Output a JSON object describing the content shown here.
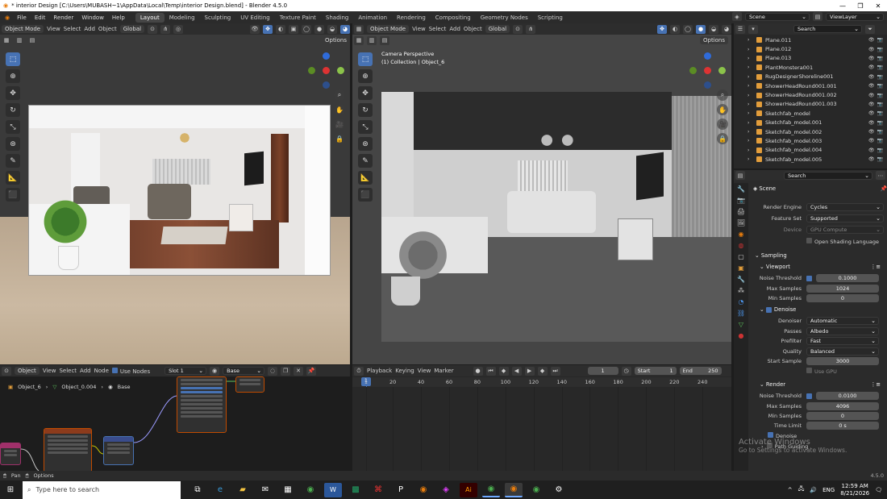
{
  "window": {
    "title": "* interior Design [C:\\Users\\MUBASH~1\\AppData\\Local\\Temp\\interior Design.blend] - Blender 4.5.0"
  },
  "menu": [
    "File",
    "Edit",
    "Render",
    "Window",
    "Help"
  ],
  "workspaces": [
    "Layout",
    "Modeling",
    "Sculpting",
    "UV Editing",
    "Texture Paint",
    "Shading",
    "Animation",
    "Rendering",
    "Compositing",
    "Geometry Nodes",
    "Scripting"
  ],
  "scene": {
    "name": "Scene",
    "view_layer": "ViewLayer"
  },
  "left_viewport": {
    "mode": "Object Mode",
    "menus": [
      "View",
      "Select",
      "Add",
      "Object"
    ],
    "orientation": "Global",
    "options": "Options"
  },
  "right_viewport": {
    "mode": "Object Mode",
    "menus": [
      "View",
      "Select",
      "Add",
      "Object"
    ],
    "orientation": "Global",
    "options": "Options",
    "camera_label": "Camera Perspective",
    "collection_label": "(1) Collection | Object_6"
  },
  "outliner": {
    "search_placeholder": "Search",
    "items": [
      {
        "name": "Plane.011"
      },
      {
        "name": "Plane.012"
      },
      {
        "name": "Plane.013"
      },
      {
        "name": "PlantMonstera001"
      },
      {
        "name": "RugDesignerShoreline001"
      },
      {
        "name": "ShowerHeadRound001.001"
      },
      {
        "name": "ShowerHeadRound001.002"
      },
      {
        "name": "ShowerHeadRound001.003"
      },
      {
        "name": "Sketchfab_model"
      },
      {
        "name": "Sketchfab_model.001"
      },
      {
        "name": "Sketchfab_model.002"
      },
      {
        "name": "Sketchfab_model.003"
      },
      {
        "name": "Sketchfab_model.004"
      },
      {
        "name": "Sketchfab_model.005"
      }
    ]
  },
  "properties": {
    "search_placeholder": "Search",
    "context": "Scene",
    "render_engine_label": "Render Engine",
    "render_engine": "Cycles",
    "feature_set_label": "Feature Set",
    "feature_set": "Supported",
    "device_label": "Device",
    "device": "GPU Compute",
    "open_shading_language": "Open Shading Language",
    "sampling": "Sampling",
    "viewport": "Viewport",
    "noise_threshold_label": "Noise Threshold",
    "viewport_noise_threshold": "0.1000",
    "max_samples_label": "Max Samples",
    "viewport_max_samples": "1024",
    "min_samples_label": "Min Samples",
    "viewport_min_samples": "0",
    "denoise": "Denoise",
    "denoiser_label": "Denoiser",
    "denoiser": "Automatic",
    "passes_label": "Passes",
    "passes": "Albedo",
    "prefilter_label": "Prefilter",
    "prefilter": "Fast",
    "quality_label": "Quality",
    "quality": "Balanced",
    "start_sample_label": "Start Sample",
    "start_sample": "3000",
    "use_gpu": "Use GPU",
    "render": "Render",
    "render_noise_threshold": "0.0100",
    "render_max_samples": "4096",
    "render_min_samples": "0",
    "time_limit_label": "Time Limit",
    "time_limit": "0 s",
    "render_denoise": "Denoise",
    "path_guiding": "Path Guiding",
    "activate_windows": "Activate Windows",
    "activate_windows_sub": "Go to Settings to activate Windows."
  },
  "node_editor": {
    "editor_type": "Object",
    "menus": [
      "View",
      "Select",
      "Add",
      "Node"
    ],
    "use_nodes": "Use Nodes",
    "slot": "Slot 1",
    "material": "Base",
    "breadcrumb": [
      "Object_6",
      "Object_0.004",
      "Base"
    ]
  },
  "timeline": {
    "menus": [
      "Playback",
      "Keying",
      "View",
      "Marker"
    ],
    "current_frame": "1",
    "start_label": "Start",
    "start": "1",
    "end_label": "End",
    "end": "250",
    "ticks": [
      "1",
      "20",
      "40",
      "60",
      "80",
      "100",
      "120",
      "140",
      "160",
      "180",
      "200",
      "220",
      "240"
    ]
  },
  "statusbar": {
    "pan": "Pan",
    "options": "Options",
    "version": "4.5.0"
  },
  "taskbar": {
    "search_placeholder": "Type here to search",
    "time": "12:59 AM",
    "date": "8/21/2026",
    "lang": "ENG"
  },
  "colors": {
    "accent": "#4772b3",
    "object_orange": "#e29d3b",
    "node_border": "#c04b00"
  }
}
